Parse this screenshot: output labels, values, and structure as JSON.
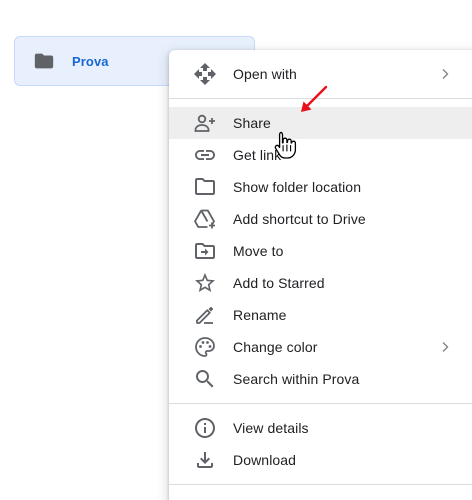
{
  "folder": {
    "name": "Prova",
    "icon": "folder-icon"
  },
  "context_menu": {
    "items": [
      {
        "label": "Open with",
        "icon": "open-with-icon",
        "submenu": true
      },
      {
        "label": "Share",
        "icon": "person-add-icon",
        "highlighted": true
      },
      {
        "label": "Get link",
        "icon": "link-icon"
      },
      {
        "label": "Show folder location",
        "icon": "folder-outline-icon"
      },
      {
        "label": "Add shortcut to Drive",
        "icon": "drive-shortcut-icon"
      },
      {
        "label": "Move to",
        "icon": "move-to-icon"
      },
      {
        "label": "Add to Starred",
        "icon": "star-outline-icon"
      },
      {
        "label": "Rename",
        "icon": "pencil-icon"
      },
      {
        "label": "Change color",
        "icon": "palette-icon",
        "submenu": true
      },
      {
        "label": "Search within Prova",
        "icon": "search-icon"
      },
      {
        "label": "View details",
        "icon": "info-icon"
      },
      {
        "label": "Download",
        "icon": "download-icon"
      }
    ]
  },
  "colors": {
    "accent": "#1967d2",
    "tile_background": "#e8f0fe",
    "highlight": "#eeeeee",
    "icon": "#5f6368",
    "annotation": "#e8101a"
  }
}
